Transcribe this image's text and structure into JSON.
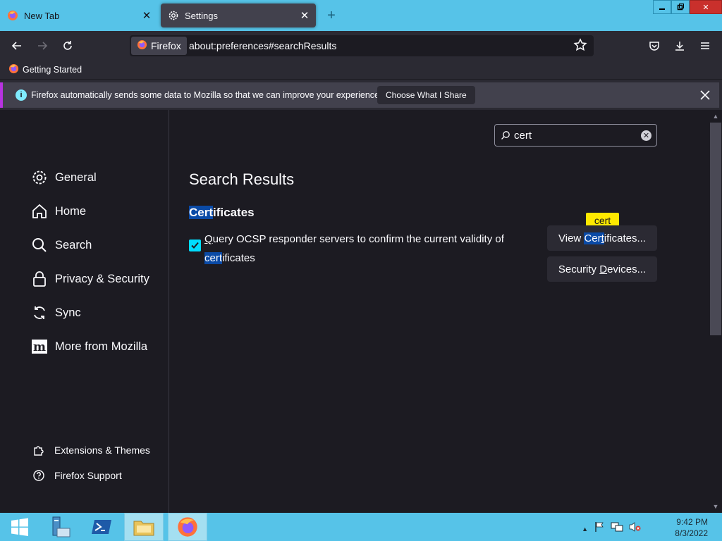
{
  "tabs": [
    {
      "label": "New Tab",
      "icon": "firefox-icon"
    },
    {
      "label": "Settings",
      "icon": "gear-icon"
    }
  ],
  "window_controls": {
    "minimize": "minimize-icon",
    "maximize": "maximize-icon",
    "close": "close-icon"
  },
  "navbar": {
    "identity_label": "Firefox",
    "url": "about:preferences#searchResults"
  },
  "bookmarks": [
    {
      "label": "Getting Started"
    }
  ],
  "notification": {
    "text": "Firefox automatically sends some data to Mozilla so that we can improve your experience.",
    "button_label": "Choose What I Share"
  },
  "sidebar": {
    "categories": [
      {
        "label": "General",
        "icon": "gear-icon"
      },
      {
        "label": "Home",
        "icon": "home-icon"
      },
      {
        "label": "Search",
        "icon": "search-icon"
      },
      {
        "label": "Privacy & Security",
        "icon": "lock-icon"
      },
      {
        "label": "Sync",
        "icon": "sync-icon"
      },
      {
        "label": "More from Mozilla",
        "icon": "mozilla-icon"
      }
    ],
    "footer_links": [
      {
        "label": "Extensions & Themes",
        "icon": "puzzle-icon"
      },
      {
        "label": "Firefox Support",
        "icon": "help-icon"
      }
    ]
  },
  "search": {
    "value": "cert"
  },
  "results": {
    "title": "Search Results",
    "section": {
      "title_highlight": "Cert",
      "title_rest": "ificates"
    },
    "checkbox": {
      "checked": true,
      "label_prefix_ul": "Q",
      "label_main": "uery OCSP responder servers to confirm the current validity of",
      "label_hl": "cert",
      "label_rest": "ificates"
    },
    "buttons": {
      "view_pre": "View ",
      "view_hl": "Cer",
      "view_hl_ul": "t",
      "view_rest": "ificates...",
      "security_pre": "Security ",
      "security_ul": "D",
      "security_rest": "evices..."
    },
    "tooltip": "cert"
  },
  "taskbar": {
    "items": [
      "start-icon",
      "server-manager-icon",
      "powershell-icon",
      "file-explorer-icon",
      "firefox-icon"
    ],
    "clock_time": "9:42 PM",
    "clock_date": "8/3/2022"
  },
  "colors": {
    "accent": "#00ddff",
    "highlight": "#0a4aa6",
    "tooltip": "#ffe900",
    "taskbar": "#56c3e8"
  }
}
